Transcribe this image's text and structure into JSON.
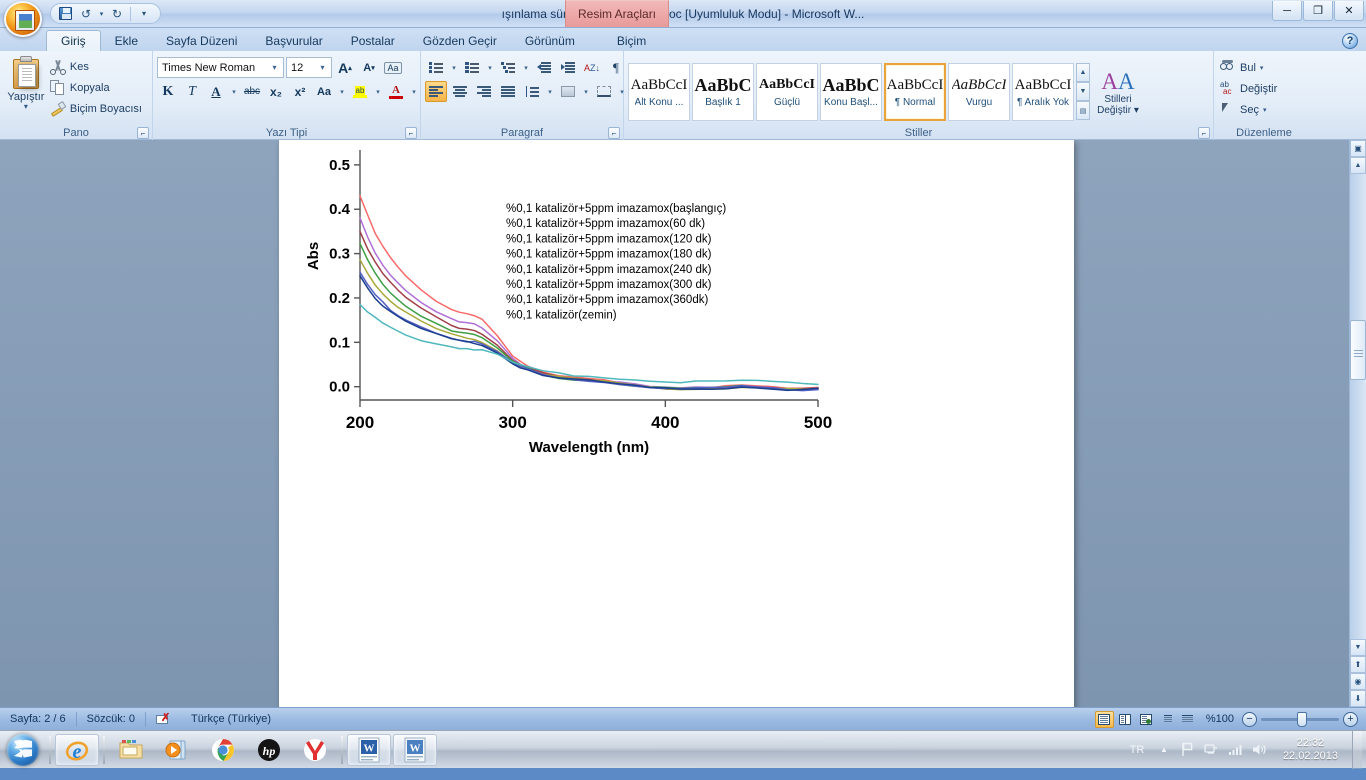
{
  "window": {
    "title": "ışınlama süresi çalışması abs.doc [Uyumluluk Modu] - Microsoft W...",
    "contextual_tab": "Resim Araçları",
    "minimize": "─",
    "maximize": "❐",
    "close": "✕",
    "help": "?"
  },
  "quick_access": {
    "save": "save-icon",
    "undo": "↺",
    "redo": "↻",
    "more": "▾"
  },
  "ribbon": {
    "tabs": [
      {
        "label": "Giriş",
        "active": true
      },
      {
        "label": "Ekle",
        "active": false
      },
      {
        "label": "Sayfa Düzeni",
        "active": false
      },
      {
        "label": "Başvurular",
        "active": false
      },
      {
        "label": "Postalar",
        "active": false
      },
      {
        "label": "Gözden Geçir",
        "active": false
      },
      {
        "label": "Görünüm",
        "active": false
      },
      {
        "label": "Biçim",
        "active": false
      }
    ],
    "groups": {
      "clipboard": {
        "label": "Pano",
        "paste": "Yapıştır",
        "cut": "Kes",
        "copy": "Kopyala",
        "format_painter": "Biçim Boyacısı"
      },
      "font": {
        "label": "Yazı Tipi",
        "font_name": "Times New Roman",
        "font_size": "12",
        "grow_font": "A",
        "shrink_font": "A",
        "clear_formatting": "Aa",
        "bold": "K",
        "italic": "T",
        "underline": "A",
        "strikethrough": "abc",
        "subscript": "x₂",
        "superscript": "x²",
        "change_case": "Aa",
        "highlight": "ab",
        "font_color": "A"
      },
      "paragraph": {
        "label": "Paragraf",
        "bullets": "bullet-list-icon",
        "numbering": "numbered-list-icon",
        "multilevel": "multilevel-list-icon",
        "decrease_indent": "decrease-indent-icon",
        "increase_indent": "increase-indent-icon",
        "sort": "sort-icon",
        "show_marks": "¶",
        "align_left": "align-left-icon",
        "align_center": "align-center-icon",
        "align_right": "align-right-icon",
        "justify": "justify-icon",
        "line_spacing": "line-spacing-icon",
        "shading": "shading-icon",
        "borders": "borders-icon"
      },
      "styles": {
        "label": "Stiller",
        "items": [
          {
            "preview": "AaBbCcI",
            "name": "Alt Konu ...",
            "selected": false,
            "style": "serif-normal"
          },
          {
            "preview": "AaBbC",
            "name": "Başlık 1",
            "selected": false,
            "style": "serif-bold-big"
          },
          {
            "preview": "AaBbCcI",
            "name": "Güçlü",
            "selected": false,
            "style": "serif-bold"
          },
          {
            "preview": "AaBbC",
            "name": "Konu Başl...",
            "selected": false,
            "style": "serif-bold-big"
          },
          {
            "preview": "AaBbCcI",
            "name": "¶ Normal",
            "selected": true,
            "style": "serif-normal"
          },
          {
            "preview": "AaBbCcI",
            "name": "Vurgu",
            "selected": false,
            "style": "serif-italic"
          },
          {
            "preview": "AaBbCcI",
            "name": "¶ Aralık Yok",
            "selected": false,
            "style": "serif-normal"
          }
        ],
        "change_styles_line1": "Stilleri",
        "change_styles_line2": "Değiştir"
      },
      "editing": {
        "label": "Düzenleme",
        "find": "Bul",
        "replace": "Değiştir",
        "select": "Seç"
      }
    }
  },
  "statusbar": {
    "page": "Sayfa: 2 / 6",
    "words": "Sözcük: 0",
    "proofing_icon": "proofing-errors-icon",
    "language": "Türkçe (Türkiye)",
    "zoom_level": "%100",
    "zoom_out": "−",
    "zoom_in": "+",
    "views": [
      {
        "name": "print-layout-view",
        "on": true
      },
      {
        "name": "full-screen-reading-view",
        "on": false
      },
      {
        "name": "web-layout-view",
        "on": false
      },
      {
        "name": "outline-view",
        "on": false
      },
      {
        "name": "draft-view",
        "on": false
      }
    ]
  },
  "taskbar": {
    "start": "start-orb",
    "items": [
      {
        "name": "internet-explorer",
        "active": true
      },
      {
        "name": "windows-explorer",
        "active": false
      },
      {
        "name": "windows-media-player",
        "active": false
      },
      {
        "name": "google-chrome",
        "active": false
      },
      {
        "name": "hp-support",
        "active": false
      },
      {
        "name": "yandex-browser",
        "active": false
      },
      {
        "name": "microsoft-word-1",
        "active": true
      },
      {
        "name": "microsoft-word-2",
        "active": true
      }
    ],
    "tray": {
      "language": "TR",
      "show_hidden": "▲",
      "action_center": "flag-icon",
      "network": "network-icon",
      "signal": "signal-icon",
      "volume": "volume-icon",
      "time": "22:32",
      "date": "22.02.2013"
    }
  },
  "chart_data": {
    "type": "line",
    "title": "",
    "xlabel": "Wavelength (nm)",
    "ylabel": "Abs",
    "xlim": [
      200,
      500
    ],
    "ylim": [
      -0.03,
      0.52
    ],
    "xticks": [
      200,
      300,
      400,
      500
    ],
    "yticks": [
      "0.0",
      "0.1",
      "0.2",
      "0.3",
      "0.4",
      "0.5"
    ],
    "grid": false,
    "legend_position": "upper-center-inside",
    "legend_has_markers": false,
    "x": [
      200,
      205,
      210,
      215,
      220,
      225,
      230,
      240,
      250,
      260,
      265,
      270,
      275,
      280,
      290,
      300,
      305,
      310,
      320,
      330,
      340,
      350,
      360,
      370,
      380,
      390,
      400,
      410,
      420,
      430,
      440,
      450,
      460,
      470,
      480,
      490,
      500
    ],
    "series": [
      {
        "name": "%0,1 katalizör+5ppm imazamox(başlangıç)",
        "color": "#fb6a6a",
        "values": [
          0.43,
          0.385,
          0.345,
          0.315,
          0.29,
          0.268,
          0.248,
          0.218,
          0.194,
          0.175,
          0.168,
          0.165,
          0.162,
          0.152,
          0.115,
          0.068,
          0.055,
          0.045,
          0.031,
          0.024,
          0.02,
          0.017,
          0.014,
          0.01,
          0.005,
          0.001,
          -0.002,
          -0.002,
          -0.002,
          -0.001,
          0.0,
          0.002,
          0.001,
          -0.001,
          -0.004,
          -0.005,
          -0.004
        ]
      },
      {
        "name": "%0,1 katalizör+5ppm imazamox(60 dk)",
        "color": "#b06fd6",
        "values": [
          0.38,
          0.338,
          0.302,
          0.275,
          0.253,
          0.234,
          0.217,
          0.191,
          0.17,
          0.152,
          0.146,
          0.143,
          0.14,
          0.131,
          0.101,
          0.063,
          0.052,
          0.043,
          0.03,
          0.023,
          0.019,
          0.016,
          0.013,
          0.009,
          0.004,
          0.0,
          -0.003,
          -0.003,
          -0.003,
          -0.002,
          -0.001,
          0.002,
          0.0,
          -0.002,
          -0.004,
          -0.005,
          -0.004
        ]
      },
      {
        "name": "%0,1 katalizör+5ppm imazamox(120 dk)",
        "color": "#a0404a",
        "values": [
          0.352,
          0.313,
          0.28,
          0.254,
          0.233,
          0.216,
          0.2,
          0.176,
          0.156,
          0.139,
          0.133,
          0.13,
          0.127,
          0.12,
          0.094,
          0.06,
          0.05,
          0.042,
          0.029,
          0.022,
          0.018,
          0.015,
          0.012,
          0.008,
          0.003,
          -0.001,
          -0.004,
          -0.004,
          -0.004,
          -0.003,
          -0.002,
          0.001,
          -0.001,
          -0.003,
          -0.005,
          -0.006,
          -0.005
        ]
      },
      {
        "name": "%0,1 katalizör+5ppm imazamox(180 dk)",
        "color": "#3f9e45",
        "values": [
          0.322,
          0.285,
          0.255,
          0.231,
          0.212,
          0.196,
          0.182,
          0.161,
          0.143,
          0.128,
          0.122,
          0.119,
          0.116,
          0.11,
          0.087,
          0.057,
          0.048,
          0.041,
          0.028,
          0.021,
          0.017,
          0.014,
          0.011,
          0.007,
          0.003,
          -0.001,
          -0.004,
          -0.004,
          -0.004,
          -0.003,
          -0.002,
          0.001,
          -0.001,
          -0.003,
          -0.005,
          -0.006,
          -0.005
        ]
      },
      {
        "name": "%0,1 katalizör+5ppm imazamox(240 dk)",
        "color": "#a9a83a",
        "values": [
          0.288,
          0.256,
          0.23,
          0.209,
          0.192,
          0.178,
          0.166,
          0.147,
          0.131,
          0.118,
          0.113,
          0.11,
          0.107,
          0.102,
          0.082,
          0.055,
          0.046,
          0.04,
          0.027,
          0.021,
          0.017,
          0.014,
          0.011,
          0.007,
          0.002,
          -0.002,
          -0.005,
          -0.005,
          -0.005,
          -0.004,
          -0.003,
          0.0,
          -0.002,
          -0.004,
          -0.006,
          -0.007,
          -0.006
        ]
      },
      {
        "name": "%0,1 katalizör+5ppm imazamox(300 dk)",
        "color": "#5660c2",
        "values": [
          0.258,
          0.23,
          0.207,
          0.189,
          0.174,
          0.162,
          0.151,
          0.135,
          0.121,
          0.109,
          0.105,
          0.102,
          0.1,
          0.095,
          0.078,
          0.053,
          0.045,
          0.039,
          0.027,
          0.02,
          0.016,
          0.013,
          0.01,
          0.006,
          0.002,
          -0.002,
          -0.005,
          -0.005,
          -0.005,
          -0.004,
          -0.003,
          0.0,
          -0.002,
          -0.004,
          -0.006,
          -0.007,
          -0.006
        ]
      },
      {
        "name": "%0,1 katalizör+5ppm imazamox(360dk)",
        "color": "#1b3f8f",
        "values": [
          0.25,
          0.223,
          0.201,
          0.184,
          0.17,
          0.158,
          0.147,
          0.131,
          0.118,
          0.107,
          0.103,
          0.1,
          0.098,
          0.093,
          0.077,
          0.052,
          0.044,
          0.038,
          0.026,
          0.02,
          0.016,
          0.013,
          0.01,
          0.006,
          0.002,
          -0.002,
          -0.005,
          -0.005,
          -0.005,
          -0.004,
          -0.003,
          0.0,
          -0.002,
          -0.004,
          -0.006,
          -0.007,
          -0.006
        ]
      },
      {
        "name": "%0,1 katalizör(zemin)",
        "color": "#4fb8bd",
        "values": [
          0.185,
          0.168,
          0.154,
          0.142,
          0.132,
          0.124,
          0.117,
          0.106,
          0.097,
          0.09,
          0.088,
          0.086,
          0.085,
          0.082,
          0.071,
          0.054,
          0.048,
          0.043,
          0.034,
          0.029,
          0.026,
          0.024,
          0.022,
          0.019,
          0.016,
          0.013,
          0.011,
          0.011,
          0.012,
          0.012,
          0.013,
          0.014,
          0.013,
          0.011,
          0.009,
          0.008,
          0.007
        ]
      }
    ]
  }
}
